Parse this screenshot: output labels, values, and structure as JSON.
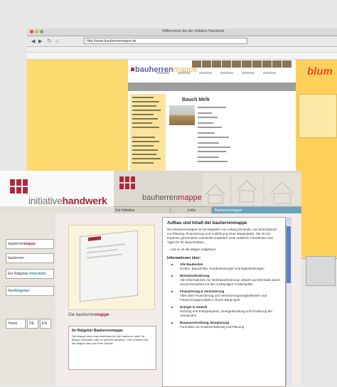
{
  "back_window": {
    "title": "Willkommen bei der Initiative Handwerk",
    "url": "http://www.bauherrenmappe.de",
    "bauherren_logo_main": "bauherren",
    "bauherren_logo_suffix": "mappe",
    "blum_logo": "blum",
    "page_heading": "Bauch Melk"
  },
  "front_window": {
    "logo": {
      "part1": "initiative",
      "part2": "handwerk"
    },
    "banner": {
      "part1": "bauherren",
      "part2": "mappe"
    },
    "nav": {
      "items": [
        "Die Initiative",
        "Links",
        "Bauherrenmappe"
      ]
    },
    "left_panel": {
      "buttons": [
        {
          "prefix": "bauherren",
          "suffix": "mappe"
        },
        {
          "prefix": "bauherren",
          "suffix": ""
        },
        {
          "prefix": "Ein Ratgeber",
          "suffix": " Immobilie"
        },
        {
          "prefix": "Neu",
          "suffix": "Ratgeber"
        }
      ],
      "bottom_buttons": [
        "Home",
        "DE",
        "EN"
      ]
    },
    "book_caption": {
      "part1": "Die bauherren",
      "part2": "mappe"
    },
    "lower_box": {
      "title": "Ihr Ratgeber Bauherrenmappe",
      "body": "Die Mappe kann man kostenlos bei der bauherrn unter Ihr Bauort vorfinden oder im Internet bestellen. Hier erhalten Sie die Mappe dann bei Ihrer Schule."
    },
    "main_text": {
      "heading": "Aufbau und Inhalt der bauherrenmappe",
      "intro": "Die bauherrenmappe ist ein Ratgeber von Anfang bis Ende, mit Informationen zur Planung, Finanzierung und Ausführung eines Bauprojekts. Sie ist von Experten geschrieben und bietet zusätzlich viele nützliche Checklisten und Tipps für Ihr Bauvorhaben.",
      "intro2": "... und so ist die Mappe aufgebaut:",
      "section_title": "Informationen über:",
      "items": [
        {
          "title": "Alle Baukosten",
          "text": "Kosten, Bauschritte, Sonderleistungen und Eigenleistungen"
        },
        {
          "title": "Wohnbauförderung",
          "text": "Alle Informationen zur Wohnbauförderung: aktuell und informativ durch Zusammenarbeit mit den zuständigen Förderstellen"
        },
        {
          "title": "Finanzierung & Versicherung",
          "text": "Alles über Finanzierung und Versicherungsmöglichkeiten und Finanzierungsmodelle in Ihrem Bauprojekt"
        },
        {
          "title": "Energie & Umwelt",
          "text": "Heizung und Energiesparen, Energieberatung und Förderung der Gemeinden"
        },
        {
          "title": "Bauausschreibung, Bauplanung",
          "text": "Formulare zur Kostenschätzung und Planung"
        }
      ]
    }
  }
}
